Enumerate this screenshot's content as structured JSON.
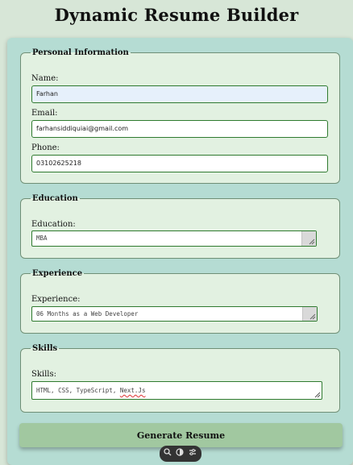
{
  "page": {
    "title": "Dynamic Resume Builder"
  },
  "personal": {
    "legend": "Personal Information",
    "name_label": "Name:",
    "name_value": "Farhan",
    "email_label": "Email:",
    "email_value": "farhansiddiquiai@gmail.com",
    "phone_label": "Phone:",
    "phone_value": "03102625218"
  },
  "education": {
    "legend": "Education",
    "label": "Education:",
    "value": "MBA"
  },
  "experience": {
    "legend": "Experience",
    "label": "Experience:",
    "value": "06 Months as a Web Developer"
  },
  "skills": {
    "legend": "Skills",
    "label": "Skills:",
    "value_prefix": "HTML, CSS, TypeScript, ",
    "value_flagged": "Next.Js"
  },
  "actions": {
    "generate_label": "Generate Resume"
  },
  "overlay": {
    "icons": [
      "search-icon",
      "contrast-icon",
      "settings-icon"
    ]
  },
  "colors": {
    "background": "#d7e6d7",
    "card": "#b5dcd3",
    "section": "#e2f1e1",
    "field_border": "#2f7a2f",
    "button": "#a1c8a0"
  }
}
